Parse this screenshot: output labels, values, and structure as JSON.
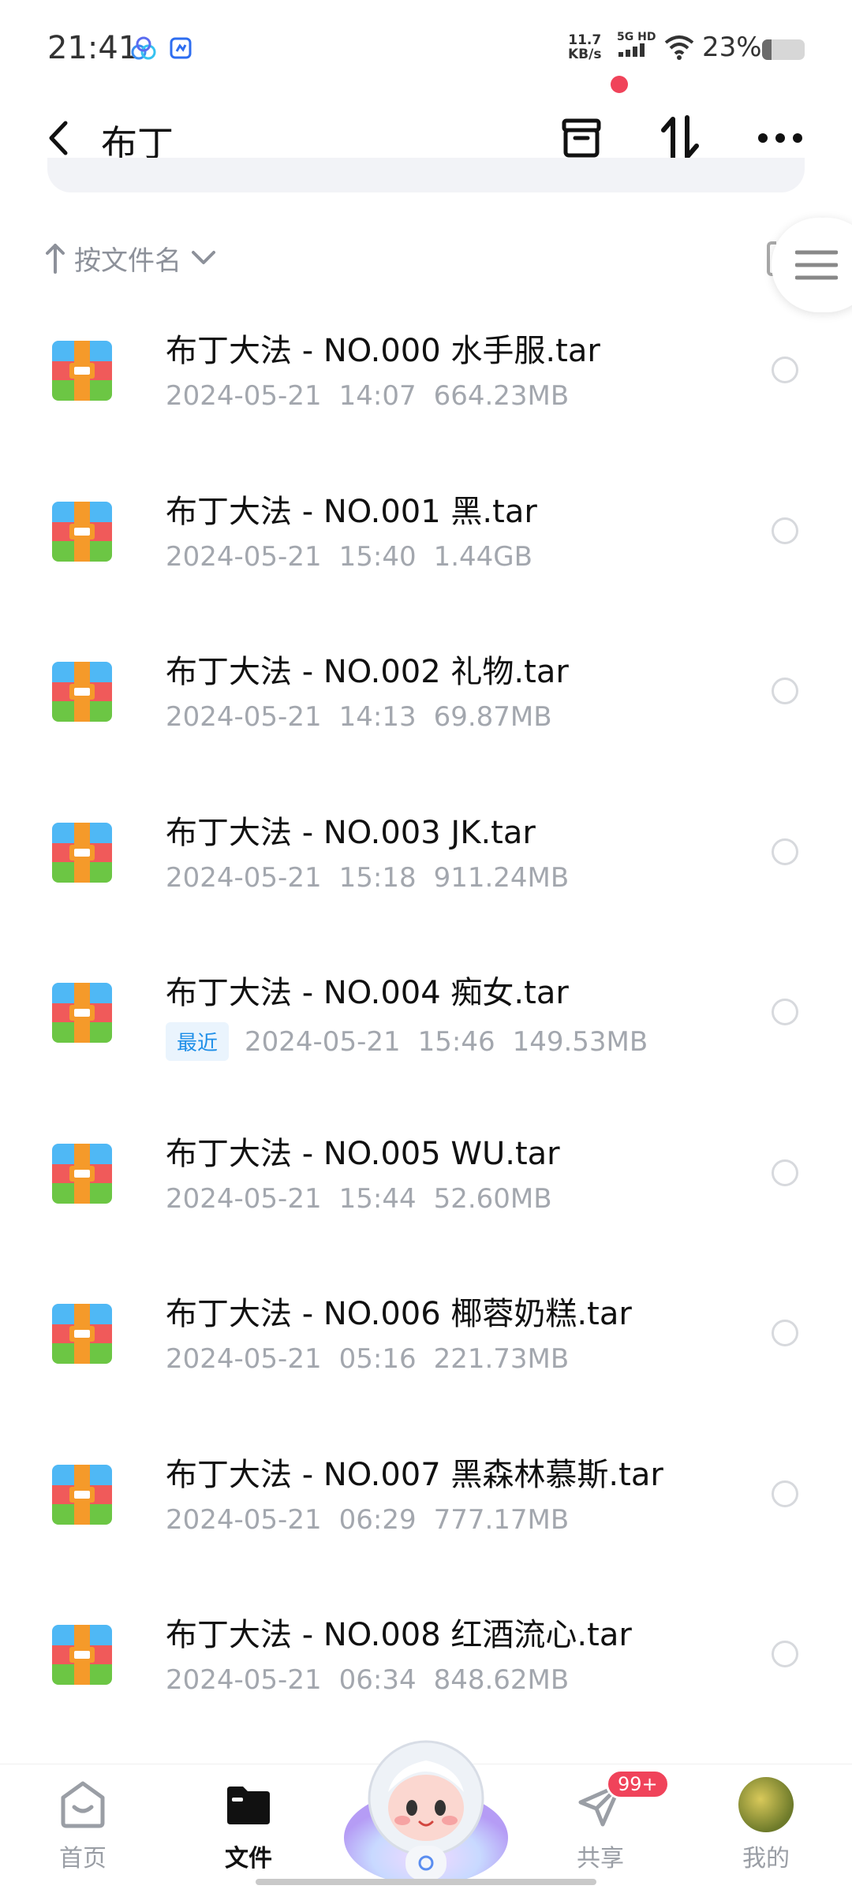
{
  "status_bar": {
    "time": "21:41",
    "speed_value": "11.7",
    "speed_unit": "KB/s",
    "network_label": "5G HD",
    "battery_percent": "23%",
    "battery_level": 0.23
  },
  "header": {
    "title": "布丁",
    "icons": [
      "back-icon",
      "archive-icon",
      "sort-icon",
      "more-icon"
    ]
  },
  "sort": {
    "label": "按文件名"
  },
  "files": [
    {
      "name": "布丁大法 - NO.000 水手服.tar",
      "badge": "",
      "date": "2024-05-21",
      "time": "14:07",
      "size": "664.23MB"
    },
    {
      "name": "布丁大法 - NO.001 黑.tar",
      "badge": "",
      "date": "2024-05-21",
      "time": "15:40",
      "size": "1.44GB"
    },
    {
      "name": "布丁大法 - NO.002 礼物.tar",
      "badge": "",
      "date": "2024-05-21",
      "time": "14:13",
      "size": "69.87MB"
    },
    {
      "name": "布丁大法 - NO.003 JK.tar",
      "badge": "",
      "date": "2024-05-21",
      "time": "15:18",
      "size": "911.24MB"
    },
    {
      "name": "布丁大法 - NO.004 痴女.tar",
      "badge": "最近",
      "date": "2024-05-21",
      "time": "15:46",
      "size": "149.53MB"
    },
    {
      "name": "布丁大法 - NO.005 WU.tar",
      "badge": "",
      "date": "2024-05-21",
      "time": "15:44",
      "size": "52.60MB"
    },
    {
      "name": "布丁大法 - NO.006 椰蓉奶糕.tar",
      "badge": "",
      "date": "2024-05-21",
      "time": "05:16",
      "size": "221.73MB"
    },
    {
      "name": "布丁大法 - NO.007 黑森林慕斯.tar",
      "badge": "",
      "date": "2024-05-21",
      "time": "06:29",
      "size": "777.17MB"
    },
    {
      "name": "布丁大法 - NO.008 红酒流心.tar",
      "badge": "",
      "date": "2024-05-21",
      "time": "06:34",
      "size": "848.62MB"
    }
  ],
  "bottom_nav": {
    "home": "首页",
    "files": "文件",
    "share": "共享",
    "share_badge": "99+",
    "mine": "我的"
  },
  "colors": {
    "accent_red": "#f0435a",
    "badge_blue": "#1d8ee8",
    "meta_gray": "#a3a7ae"
  }
}
